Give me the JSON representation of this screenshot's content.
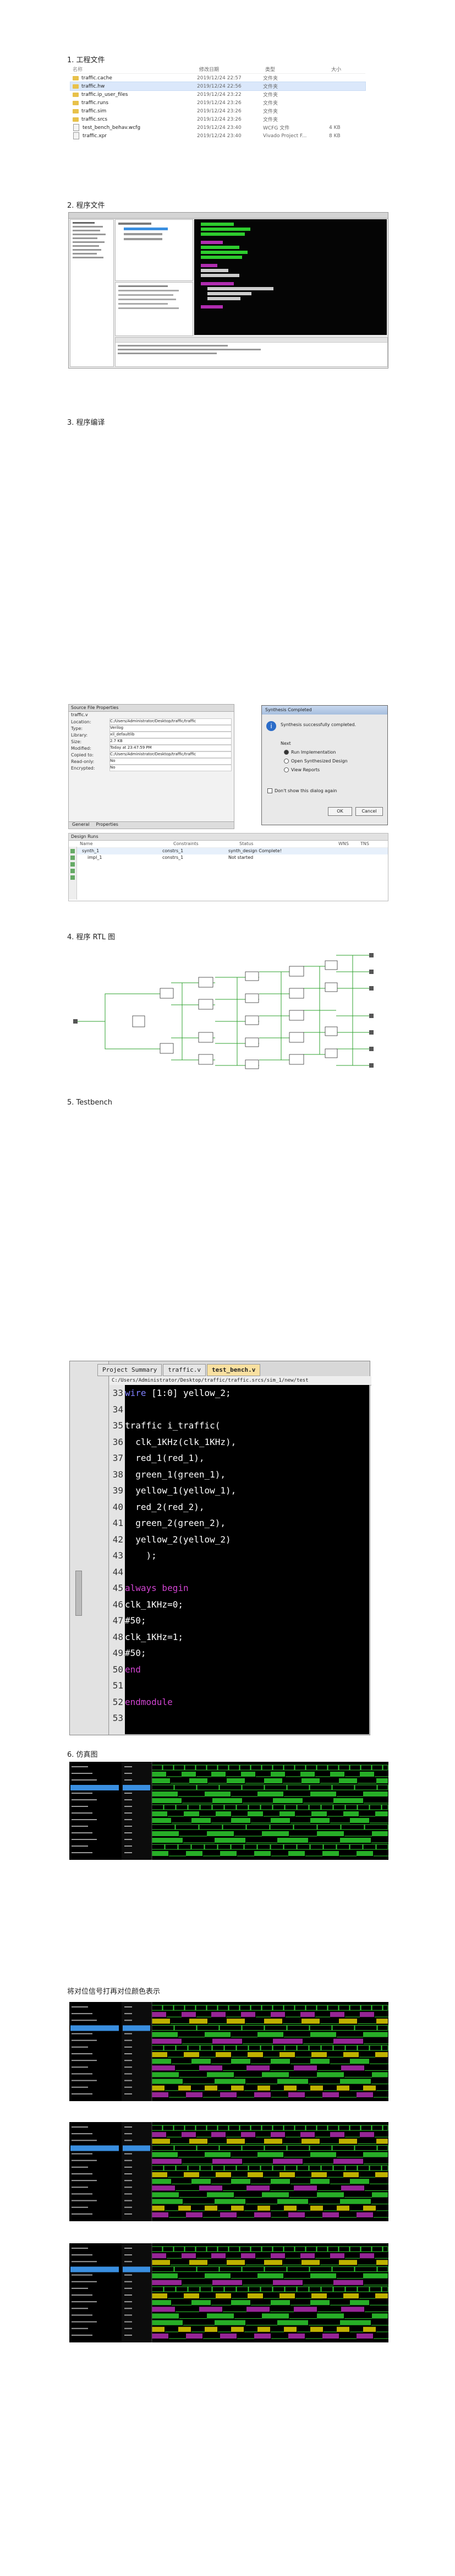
{
  "sections": {
    "s1": "1. 工程文件",
    "s2": "2. 程序文件",
    "s3": "3. 程序编译",
    "s4": "4. 程序 RTL 图",
    "s5": "5. Testbench",
    "s6": "6. 仿真图",
    "s7": "将对位信号打再对位颜色表示"
  },
  "files": {
    "headers": [
      "名称",
      "修改日期",
      "类型",
      "大小"
    ],
    "rows": [
      {
        "name": "traffic.cache",
        "date": "2019/12/24 22:57",
        "type": "文件夹",
        "size": "",
        "icon": "folder"
      },
      {
        "name": "traffic.hw",
        "date": "2019/12/24 22:56",
        "type": "文件夹",
        "size": "",
        "icon": "folder"
      },
      {
        "name": "traffic.ip_user_files",
        "date": "2019/12/24 23:22",
        "type": "文件夹",
        "size": "",
        "icon": "folder"
      },
      {
        "name": "traffic.runs",
        "date": "2019/12/24 23:26",
        "type": "文件夹",
        "size": "",
        "icon": "folder"
      },
      {
        "name": "traffic.sim",
        "date": "2019/12/24 23:26",
        "type": "文件夹",
        "size": "",
        "icon": "folder"
      },
      {
        "name": "traffic.srcs",
        "date": "2019/12/24 23:26",
        "type": "文件夹",
        "size": "",
        "icon": "folder"
      },
      {
        "name": "test_bench_behav.wcfg",
        "date": "2019/12/24 23:40",
        "type": "WCFG 文件",
        "size": "4 KB",
        "icon": "file"
      },
      {
        "name": "traffic.xpr",
        "date": "2019/12/24 23:40",
        "type": "Vivado Project F...",
        "size": "8 KB",
        "icon": "file"
      }
    ]
  },
  "props": {
    "title": "Source File Properties",
    "file": "traffic.v",
    "rows": [
      {
        "k": "Location:",
        "v": "C:/Users/Administrator/Desktop/traffic/traffic"
      },
      {
        "k": "Type:",
        "v": "Verilog"
      },
      {
        "k": "Library:",
        "v": "xil_defaultlib"
      },
      {
        "k": "Size:",
        "v": "2.7 KB"
      },
      {
        "k": "Modified:",
        "v": "Today at 23:47:59 PM"
      },
      {
        "k": "Copied to:",
        "v": "C:/Users/Administrator/Desktop/traffic/traffic"
      },
      {
        "k": "Read-only:",
        "v": "No"
      },
      {
        "k": "Encrypted:",
        "v": "No"
      }
    ],
    "tabs": [
      "General",
      "Properties"
    ]
  },
  "dialog": {
    "title": "Synthesis Completed",
    "message": "Synthesis successfully completed.",
    "next_label": "Next",
    "options": [
      "Run Implementation",
      "Open Synthesized Design",
      "View Reports"
    ],
    "checkbox": "Don't show this dialog again",
    "ok": "OK",
    "cancel": "Cancel"
  },
  "design_runs": {
    "title": "Design Runs",
    "headers": [
      "Name",
      "Constraints",
      "Status",
      "WNS",
      "TNS"
    ],
    "rows": [
      {
        "name": "synth_1",
        "constraints": "constrs_1",
        "status": "synth_design Complete!"
      },
      {
        "name": "impl_1",
        "constraints": "constrs_1",
        "status": "Not started"
      }
    ]
  },
  "testbench": {
    "tabs": [
      "Project Summary",
      "traffic.v",
      "test_bench.v"
    ],
    "path": "C:/Users/Administrator/Desktop/traffic/traffic.srcs/sim_1/new/test",
    "lines": [
      {
        "n": "33",
        "code": "wire [1:0] yellow_2;",
        "cls": ""
      },
      {
        "n": "34",
        "code": "",
        "cls": ""
      },
      {
        "n": "35",
        "code": "traffic i_traffic(",
        "cls": ""
      },
      {
        "n": "36",
        "code": "  clk_1KHz(clk_1KHz),",
        "cls": ""
      },
      {
        "n": "37",
        "code": "  red_1(red_1),",
        "cls": ""
      },
      {
        "n": "38",
        "code": "  green_1(green_1),",
        "cls": ""
      },
      {
        "n": "39",
        "code": "  yellow_1(yellow_1),",
        "cls": ""
      },
      {
        "n": "40",
        "code": "  red_2(red_2),",
        "cls": ""
      },
      {
        "n": "41",
        "code": "  green_2(green_2),",
        "cls": ""
      },
      {
        "n": "42",
        "code": "  yellow_2(yellow_2)",
        "cls": ""
      },
      {
        "n": "43",
        "code": "    );",
        "cls": ""
      },
      {
        "n": "44",
        "code": "",
        "cls": ""
      },
      {
        "n": "45",
        "code": "always begin",
        "cls": "kw2"
      },
      {
        "n": "46",
        "code": "clk_1KHz=0;",
        "cls": ""
      },
      {
        "n": "47",
        "code": "#50;",
        "cls": ""
      },
      {
        "n": "48",
        "code": "clk_1KHz=1;",
        "cls": ""
      },
      {
        "n": "49",
        "code": "#50;",
        "cls": ""
      },
      {
        "n": "50",
        "code": "end",
        "cls": "kw2"
      },
      {
        "n": "51",
        "code": "",
        "cls": ""
      },
      {
        "n": "52",
        "code": "endmodule",
        "cls": "kw2"
      },
      {
        "n": "53",
        "code": "",
        "cls": ""
      }
    ]
  },
  "colors": {
    "wave_green": "#2ecc2e",
    "wave_magenta": "#b02cb0",
    "wave_yellow": "#e0d000",
    "sel_blue": "#3a8fe0"
  }
}
